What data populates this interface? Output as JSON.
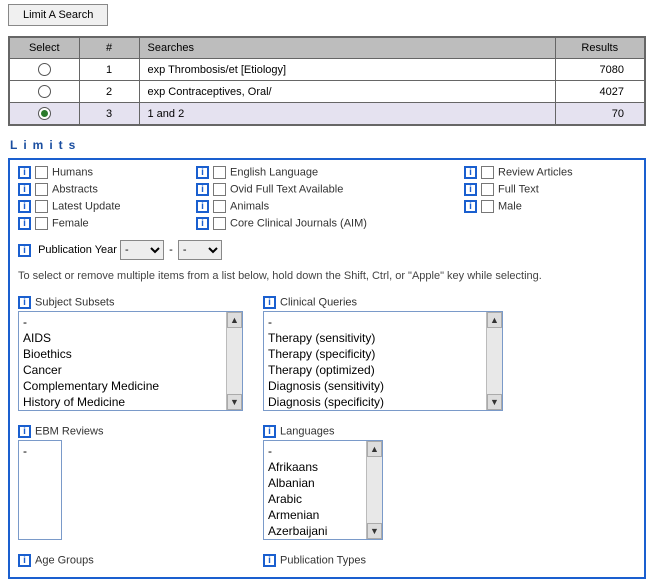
{
  "buttons": {
    "limit_search": "Limit A Search"
  },
  "table": {
    "headers": {
      "select": "Select",
      "num": "#",
      "searches": "Searches",
      "results": "Results"
    },
    "rows": [
      {
        "num": "1",
        "search": "exp Thrombosis/et [Etiology]",
        "results": "7080",
        "selected": false
      },
      {
        "num": "2",
        "search": "exp Contraceptives, Oral/",
        "results": "4027",
        "selected": false
      },
      {
        "num": "3",
        "search": "1 and 2",
        "results": "70",
        "selected": true
      }
    ]
  },
  "limits_title": "Limits",
  "checks": {
    "humans": "Humans",
    "english": "English Language",
    "review": "Review Articles",
    "abstracts": "Abstracts",
    "ovid_full": "Ovid Full Text Available",
    "full_text": "Full Text",
    "latest": "Latest Update",
    "animals": "Animals",
    "male": "Male",
    "female": "Female",
    "core": "Core Clinical Journals (AIM)"
  },
  "pub_year": {
    "label": "Publication Year",
    "from": "-",
    "to": "-",
    "dash": "-"
  },
  "hint": "To select or remove multiple items from a list below, hold down the Shift, Ctrl, or \"Apple\" key while selecting.",
  "subject_subsets": {
    "label": "Subject Subsets",
    "items": [
      "-",
      "AIDS",
      "Bioethics",
      "Cancer",
      "Complementary Medicine",
      "History of Medicine"
    ]
  },
  "clinical_queries": {
    "label": "Clinical Queries",
    "items": [
      "-",
      "Therapy (sensitivity)",
      "Therapy (specificity)",
      "Therapy (optimized)",
      "Diagnosis (sensitivity)",
      "Diagnosis (specificity)"
    ]
  },
  "ebm_reviews": {
    "label": "EBM Reviews",
    "items": [
      "-"
    ]
  },
  "languages": {
    "label": "Languages",
    "items": [
      "-",
      "Afrikaans",
      "Albanian",
      "Arabic",
      "Armenian",
      "Azerbaijani"
    ]
  },
  "age_groups": {
    "label": "Age Groups"
  },
  "pub_types": {
    "label": "Publication Types"
  }
}
